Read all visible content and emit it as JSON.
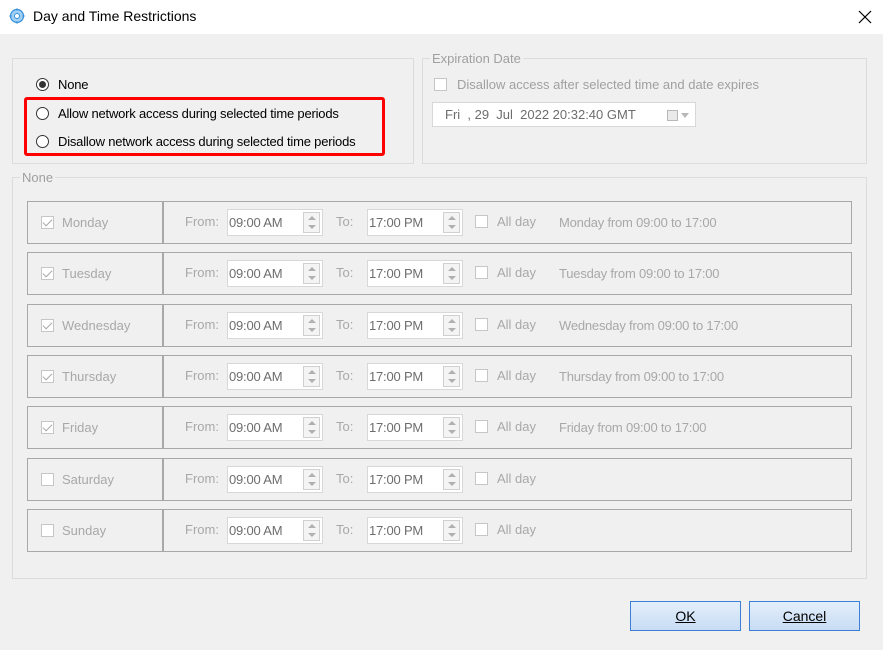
{
  "window": {
    "title": "Day and Time Restrictions",
    "title_icon": "gear-icon",
    "close_icon": "close-icon"
  },
  "access_options": [
    {
      "label": "None",
      "selected": true
    },
    {
      "label": "Allow network access during selected time periods",
      "selected": false
    },
    {
      "label": "Disallow network access during selected time periods",
      "selected": false
    }
  ],
  "expiration": {
    "legend": "Expiration Date",
    "checkbox_label": "Disallow access after selected time and date expires",
    "checked": false,
    "date_value": "Fri  , 29  Jul  2022 20:32:40 GMT"
  },
  "schedule": {
    "legend": "None",
    "from_label": "From:",
    "to_label": "To:",
    "all_day_label": "All day",
    "days": [
      {
        "name": "Monday",
        "checked": true,
        "from": "09:00 AM",
        "to": "17:00 PM",
        "summary": "Monday from 09:00 to 17:00"
      },
      {
        "name": "Tuesday",
        "checked": true,
        "from": "09:00 AM",
        "to": "17:00 PM",
        "summary": "Tuesday from 09:00 to 17:00"
      },
      {
        "name": "Wednesday",
        "checked": true,
        "from": "09:00 AM",
        "to": "17:00 PM",
        "summary": "Wednesday from 09:00 to 17:00"
      },
      {
        "name": "Thursday",
        "checked": true,
        "from": "09:00 AM",
        "to": "17:00 PM",
        "summary": "Thursday from 09:00 to 17:00"
      },
      {
        "name": "Friday",
        "checked": true,
        "from": "09:00 AM",
        "to": "17:00 PM",
        "summary": "Friday from 09:00 to 17:00"
      },
      {
        "name": "Saturday",
        "checked": false,
        "from": "09:00 AM",
        "to": "17:00 PM",
        "summary": ""
      },
      {
        "name": "Sunday",
        "checked": false,
        "from": "09:00 AM",
        "to": "17:00 PM",
        "summary": ""
      }
    ]
  },
  "buttons": {
    "ok": "OK",
    "cancel": "Cancel"
  },
  "colors": {
    "highlight": "#ff0000",
    "disabled_text": "#a8a8a8",
    "button_border": "#3c7fd6"
  }
}
